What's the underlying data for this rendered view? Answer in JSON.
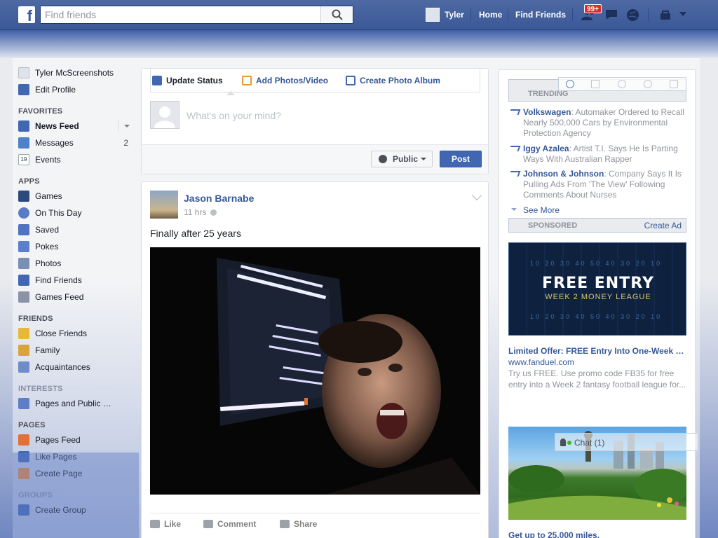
{
  "topbar": {
    "logo": "f",
    "search_placeholder": "Find friends",
    "user_name": "Tyler",
    "home": "Home",
    "find_friends": "Find Friends",
    "notification_count": "99+"
  },
  "leftnav": {
    "profile_name": "Tyler McScreenshots",
    "edit_profile": "Edit Profile",
    "sections": {
      "favorites": "FAVORITES",
      "apps": "APPS",
      "friends": "FRIENDS",
      "interests": "INTERESTS",
      "pages": "PAGES",
      "groups": "GROUPS"
    },
    "favorites": [
      {
        "label": "News Feed",
        "icon": "newsfeed-icon"
      },
      {
        "label": "Messages",
        "icon": "messages-icon",
        "count": "2"
      },
      {
        "label": "Events",
        "icon": "events-icon",
        "day": "19"
      }
    ],
    "apps": [
      {
        "label": "Games",
        "icon": "games-icon"
      },
      {
        "label": "On This Day",
        "icon": "clock-icon"
      },
      {
        "label": "Saved",
        "icon": "bookmark-icon"
      },
      {
        "label": "Pokes",
        "icon": "poke-icon"
      },
      {
        "label": "Photos",
        "icon": "photos-icon"
      },
      {
        "label": "Find Friends",
        "icon": "friends-icon"
      },
      {
        "label": "Games Feed",
        "icon": "gamepad-icon"
      }
    ],
    "friends": [
      {
        "label": "Close Friends",
        "icon": "star-icon"
      },
      {
        "label": "Family",
        "icon": "house-icon"
      },
      {
        "label": "Acquaintances",
        "icon": "people-icon"
      }
    ],
    "interests": [
      {
        "label": "Pages and Public …",
        "icon": "pages-icon"
      }
    ],
    "pages": [
      {
        "label": "Pages Feed",
        "icon": "megaphone-icon"
      },
      {
        "label": "Like Pages",
        "icon": "thumbs-up-icon"
      },
      {
        "label": "Create Page",
        "icon": "create-page-icon"
      }
    ],
    "groups": [
      {
        "label": "Create Group",
        "icon": "plus-icon"
      }
    ]
  },
  "composer": {
    "tabs": [
      "Update Status",
      "Add Photos/Video",
      "Create Photo Album"
    ],
    "placeholder": "What's on your mind?",
    "privacy": "Public",
    "post": "Post"
  },
  "story": {
    "author": "Jason Barnabe",
    "time": "11 hrs",
    "text": "Finally after 25 years",
    "actions": [
      "Like",
      "Comment",
      "Share"
    ]
  },
  "rightcol": {
    "trending_label": "TRENDING",
    "trending": [
      {
        "topic": "Volkswagen",
        "desc": ": Automaker Ordered to Recall Nearly 500,000 Cars by Environmental Protection Agency"
      },
      {
        "topic": "Iggy Azalea",
        "desc": ": Artist T.I. Says He Is Parting Ways With Australian Rapper"
      },
      {
        "topic": "Johnson & Johnson",
        "desc": ": Company Says It Is Pulling Ads From 'The View' Following Comments About Nurses"
      }
    ],
    "see_more": "See More",
    "sponsored_label": "SPONSORED",
    "create_ad": "Create Ad",
    "ad1": {
      "image_big": "FREE ENTRY",
      "image_small": "WEEK 2 MONEY LEAGUE",
      "yard_top": "10 20 30 40 50 40 30 20 10",
      "yard_bottom": "10 20 30 40 50 40 30 20 10",
      "title": "Limited Offer: FREE Entry Into One-Week …",
      "url": "www.fanduel.com",
      "body": "Try us FREE. Use promo code FB35 for free entry into a Week 2 fantasy football league for..."
    },
    "ad2": {
      "title": "Get up to 25,000 miles."
    },
    "chat": "Chat (1)"
  }
}
